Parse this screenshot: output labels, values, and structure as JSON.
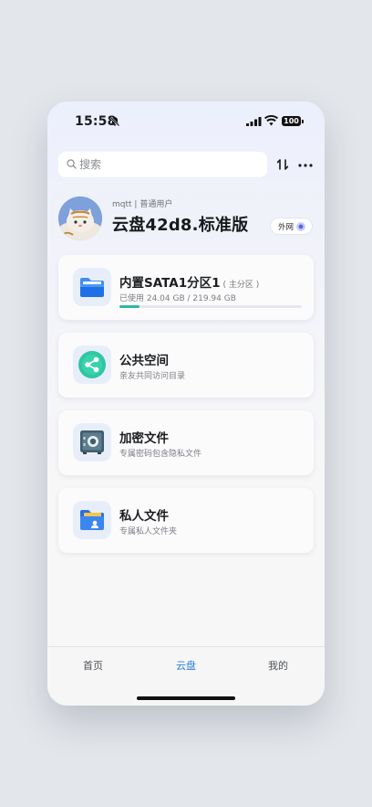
{
  "status": {
    "time": "15:58",
    "battery": "100"
  },
  "search": {
    "placeholder": "搜索"
  },
  "profile": {
    "username": "mqtt",
    "role": "普通用户",
    "separator": "|",
    "disk_name": "云盘42d8.标准版",
    "network_label": "外网"
  },
  "cards": [
    {
      "title": "内置SATA1分区1",
      "tag": "( 主分区 )",
      "subtitle": "已使用 24.04 GB / 219.94 GB",
      "used_fraction": 0.109,
      "icon": "folder-icon"
    },
    {
      "title": "公共空间",
      "subtitle": "亲友共同访问目录",
      "icon": "share-icon"
    },
    {
      "title": "加密文件",
      "subtitle": "专属密码包含隐私文件",
      "icon": "safe-icon"
    },
    {
      "title": "私人文件",
      "subtitle": "专属私人文件夹",
      "icon": "private-folder-icon"
    }
  ],
  "tabs": [
    {
      "label": "首页",
      "active": false
    },
    {
      "label": "云盘",
      "active": true
    },
    {
      "label": "我的",
      "active": false
    }
  ],
  "colors": {
    "accent": "#2d7ddb",
    "progress": "#2fb8a0",
    "share_icon": "#2fc6a3"
  }
}
